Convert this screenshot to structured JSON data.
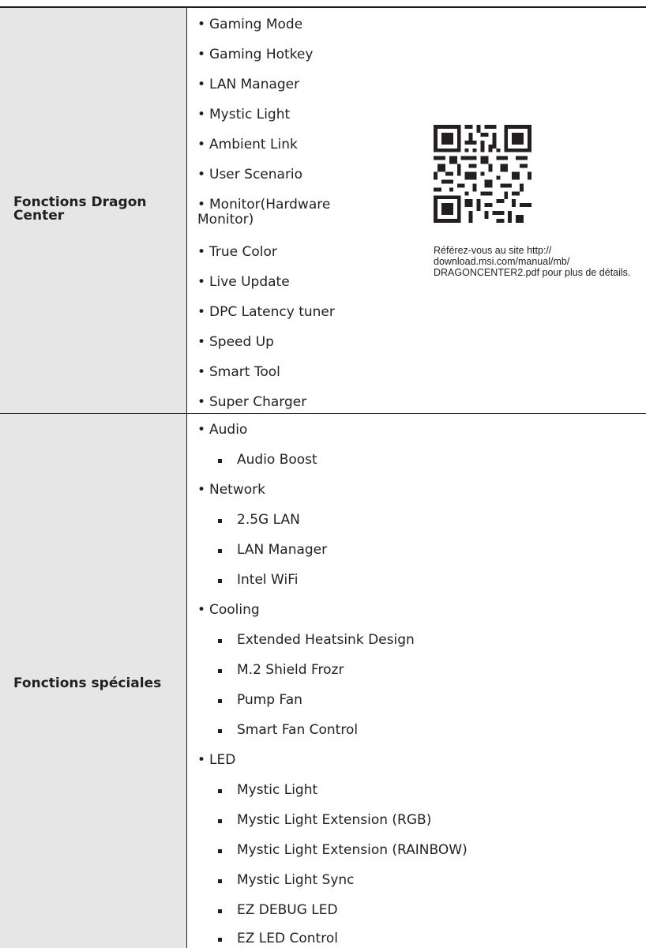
{
  "dragon": {
    "label": "Fonctions Dragon Center",
    "items": [
      "Gaming Mode",
      "Gaming Hotkey",
      "LAN Manager",
      "Mystic Light",
      "Ambient Link",
      "User Scenario",
      "Monitor(Hardware Monitor)",
      "True Color",
      "Live Update",
      "DPC Latency tuner",
      "Speed Up",
      "Smart Tool",
      "Super Charger"
    ],
    "qr_icon": "qr-code",
    "note": "Référez-vous au site http:// download.msi.com/manual/mb/ DRAGONCENTER2.pdf pour plus de détails."
  },
  "special": {
    "label": "Fonctions spéciales",
    "groups": [
      {
        "name": "Audio",
        "subs": [
          "Audio Boost"
        ]
      },
      {
        "name": "Network",
        "subs": [
          "2.5G LAN",
          "LAN Manager",
          "Intel WiFi"
        ]
      },
      {
        "name": "Cooling",
        "subs": [
          "Extended Heatsink Design",
          "M.2 Shield Frozr",
          "Pump Fan",
          "Smart Fan Control"
        ]
      },
      {
        "name": "LED",
        "subs": [
          "Mystic Light",
          "Mystic Light Extension (RGB)",
          "Mystic Light Extension (RAINBOW)",
          "Mystic Light Sync",
          "EZ DEBUG LED",
          "EZ LED Control"
        ]
      }
    ]
  }
}
